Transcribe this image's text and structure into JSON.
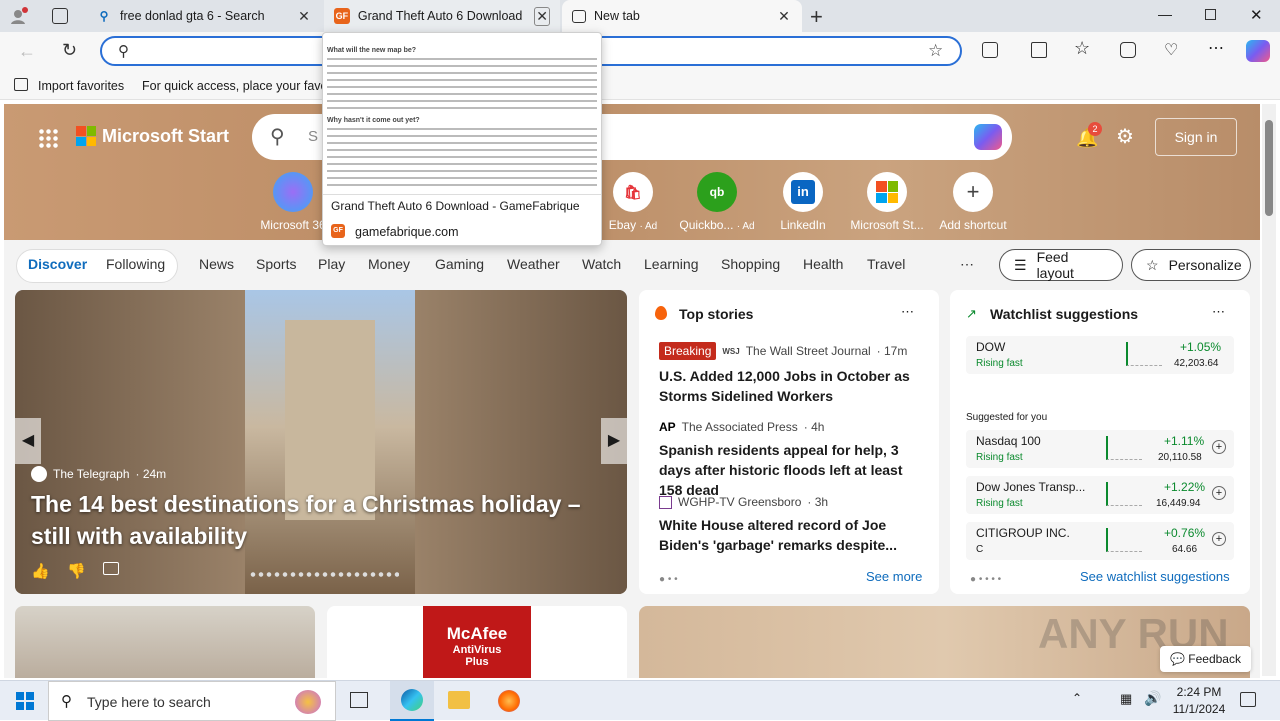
{
  "tabs": [
    {
      "label": "free donlad gta 6 - Search",
      "icon": "search-icon"
    },
    {
      "label": "Grand Theft Auto 6 Download - G",
      "icon": "gf-favicon"
    },
    {
      "label": "New tab",
      "icon": "newtab-icon"
    }
  ],
  "address": {
    "value": ""
  },
  "favbar": {
    "import": "Import favorites",
    "hint": "For quick access, place your favori"
  },
  "hover_card": {
    "title": "Grand Theft Auto 6 Download - GameFabrique",
    "domain": "gamefabrique.com",
    "preview_lines": [
      "What will the new map be?",
      "Why hasn't it come out yet?"
    ]
  },
  "msn": {
    "brand": "Microsoft Start",
    "search_placeholder": "S",
    "notif_count": "2",
    "signin": "Sign in"
  },
  "shortcuts": [
    {
      "label": "Microsoft 36",
      "icon": "copilot-365-icon"
    },
    {
      "label": "Ebay",
      "ad": "· Ad",
      "icon": "ebay-icon"
    },
    {
      "label": "Quickbo...",
      "ad": "· Ad",
      "icon": "quickbooks-icon"
    },
    {
      "label": "LinkedIn",
      "icon": "linkedin-icon"
    },
    {
      "label": "Microsoft St...",
      "icon": "microsoft-store-icon"
    },
    {
      "label": "Add shortcut",
      "icon": "plus-icon"
    }
  ],
  "nav": {
    "discover": "Discover",
    "following": "Following",
    "items": [
      "News",
      "Sports",
      "Play",
      "Money",
      "Gaming",
      "Weather",
      "Watch",
      "Learning",
      "Shopping",
      "Health",
      "Travel"
    ],
    "feed_layout": "Feed layout",
    "personalize": "Personalize"
  },
  "feature": {
    "source": "The Telegraph",
    "time": "· 24m",
    "title": "The 14 best destinations for a Christmas holiday – still with availability"
  },
  "top_stories": {
    "heading": "Top stories",
    "see_more": "See more",
    "stories": [
      {
        "badge": "Breaking",
        "source": "The Wall Street Journal",
        "time": "· 17m",
        "title": "U.S. Added 12,000 Jobs in October as Storms Sidelined Workers"
      },
      {
        "source": "The Associated Press",
        "time": "· 4h",
        "title": "Spanish residents appeal for help, 3 days after historic floods left at least 158 dead"
      },
      {
        "source": "WGHP-TV Greensboro",
        "time": "· 3h",
        "title": "White House altered record of Joe Biden's 'garbage' remarks despite..."
      }
    ]
  },
  "watchlist": {
    "heading": "Watchlist suggestions",
    "suggested": "Suggested for you",
    "see_all": "See watchlist suggestions",
    "top": {
      "name": "DOW",
      "status": "Rising fast",
      "change": "+1.05%",
      "price": "42,203.64"
    },
    "rows": [
      {
        "name": "Nasdaq 100",
        "status": "Rising fast",
        "change": "+1.11%",
        "price": "20,110.58"
      },
      {
        "name": "Dow Jones Transp...",
        "status": "Rising fast",
        "change": "+1.22%",
        "price": "16,449.94"
      },
      {
        "name": "CITIGROUP INC.",
        "status": "C",
        "change": "+0.76%",
        "price": "64.66"
      }
    ]
  },
  "mcafee": {
    "brand": "McAfee",
    "product": "AntiVirus Plus"
  },
  "feedback": "Feedback",
  "watermark": "ANY RUN",
  "taskbar": {
    "search": "Type here to search",
    "time": "2:24 PM",
    "date": "11/1/2024"
  },
  "colors": {
    "accent": "#0f6cbd",
    "up": "#0b8a2e",
    "breaking": "#c42b1c"
  }
}
